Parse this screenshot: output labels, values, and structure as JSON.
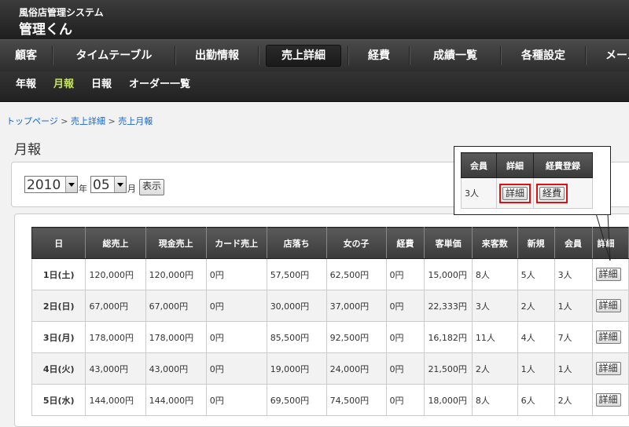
{
  "header": {
    "subtitle": "風俗店管理システム",
    "title": "管理くん"
  },
  "main_nav": [
    {
      "label": "顧客",
      "active": false
    },
    {
      "label": "タイムテーブル",
      "active": false
    },
    {
      "label": "出勤情報",
      "active": false
    },
    {
      "label": "売上詳細",
      "active": true
    },
    {
      "label": "経費",
      "active": false
    },
    {
      "label": "成績一覧",
      "active": false
    },
    {
      "label": "各種設定",
      "active": false
    },
    {
      "label": "メール",
      "active": false
    }
  ],
  "sub_nav": [
    {
      "label": "年報",
      "active": false
    },
    {
      "label": "月報",
      "active": true
    },
    {
      "label": "日報",
      "active": false
    },
    {
      "label": "オーダー一覧",
      "active": false
    }
  ],
  "breadcrumb": {
    "items": [
      "トップページ",
      "売上詳細",
      "売上月報"
    ],
    "separator": ">"
  },
  "page_title": "月報",
  "filter": {
    "year": "2010",
    "year_unit": "年",
    "month": "05",
    "month_unit": "月",
    "show_button": "表示"
  },
  "table": {
    "columns": [
      "日",
      "総売上",
      "現金売上",
      "カード売上",
      "店落ち",
      "女の子",
      "経費",
      "客単価",
      "来客数",
      "新規",
      "会員",
      "詳細"
    ],
    "rows": [
      {
        "day": "1日(土)",
        "day_type": "sat",
        "cells": [
          "120,000円",
          "120,000円",
          "0円",
          "57,500円",
          "62,500円",
          "0円",
          "15,000円",
          "8人",
          "5人",
          "3人"
        ],
        "button": "詳細"
      },
      {
        "day": "2日(日)",
        "day_type": "sun",
        "cells": [
          "67,000円",
          "67,000円",
          "0円",
          "30,000円",
          "37,000円",
          "0円",
          "22,333円",
          "3人",
          "2人",
          "1人"
        ],
        "button": "詳細"
      },
      {
        "day": "3日(月)",
        "day_type": "weekday",
        "cells": [
          "178,000円",
          "178,000円",
          "0円",
          "85,500円",
          "92,500円",
          "0円",
          "16,182円",
          "11人",
          "4人",
          "7人"
        ],
        "button": "詳細"
      },
      {
        "day": "4日(火)",
        "day_type": "weekday",
        "cells": [
          "43,000円",
          "43,000円",
          "0円",
          "19,000円",
          "24,000円",
          "0円",
          "21,500円",
          "2人",
          "1人",
          "1人"
        ],
        "button": "詳細"
      },
      {
        "day": "5日(水)",
        "day_type": "weekday",
        "cells": [
          "144,000円",
          "144,000円",
          "0円",
          "69,500円",
          "74,500円",
          "0円",
          "18,000円",
          "8人",
          "6人",
          "2人"
        ],
        "button": "詳細"
      }
    ]
  },
  "callout": {
    "columns": [
      "会員",
      "詳細",
      "経費登録"
    ],
    "member": "3人",
    "detail_button": "詳細",
    "expense_button": "経費"
  },
  "colors": {
    "saturday": "#1330b8",
    "sunday": "#d00000",
    "active_subnav": "#c6e35a",
    "highlight": "#e01010"
  }
}
